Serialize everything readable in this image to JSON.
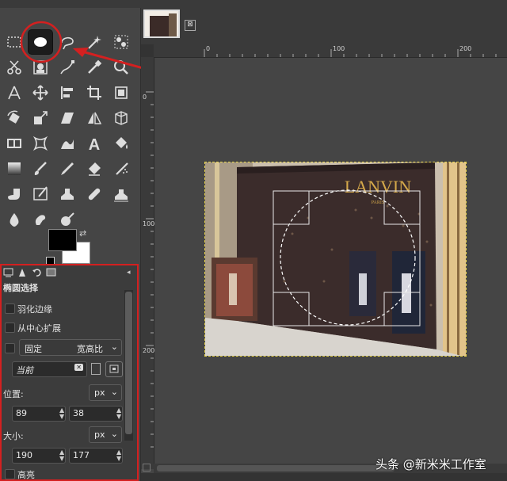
{
  "tool_options": {
    "title": "椭圆选择",
    "feather_label": "羽化边缘",
    "expand_label": "从中心扩展",
    "fixed_label": "固定",
    "fixed_mode": "宽高比",
    "preset_value": "当前",
    "position_label": "位置:",
    "position_unit": "px",
    "position_x": "89",
    "position_y": "38",
    "size_label": "大小:",
    "size_unit": "px",
    "size_w": "190",
    "size_h": "177",
    "highlight_label": "高亮"
  },
  "image_tab": {
    "close_symbol": "⊠"
  },
  "ruler": {
    "h_labels": [
      "0",
      "100",
      "200"
    ],
    "v_labels": [
      "0",
      "100",
      "200"
    ]
  },
  "photo": {
    "sign_text": "LANVIN",
    "sign_sub": "PARIS"
  },
  "watermark": "头条 @新米米工作室",
  "colors": {
    "highlight_red": "#d42020",
    "selection_dash": "#ffffff",
    "foreground": "#000000",
    "background": "#ffffff"
  },
  "icons": [
    "rect-select-icon",
    "ellipse-select-icon",
    "free-select-icon",
    "fuzzy-select-icon",
    "by-color-select-icon",
    "scissors-select-icon",
    "foreground-select-icon",
    "paths-icon",
    "color-picker-icon",
    "zoom-icon",
    "measure-icon",
    "move-icon",
    "align-icon",
    "crop-icon",
    "unified-transform-icon",
    "rotate-icon",
    "scale-icon",
    "shear-icon",
    "flip-icon",
    "perspective-icon",
    "cage-transform-icon",
    "warp-transform-icon",
    "handle-transform-icon",
    "text-icon",
    "bucket-fill-icon",
    "gradient-icon",
    "paintbrush-icon",
    "pencil-icon",
    "eraser-icon",
    "airbrush-icon",
    "ink-icon",
    "mypaint-brush-icon",
    "clone-icon",
    "heal-icon",
    "perspective-clone-icon",
    "blur-icon",
    "smudge-icon",
    "dodge-burn-icon"
  ]
}
